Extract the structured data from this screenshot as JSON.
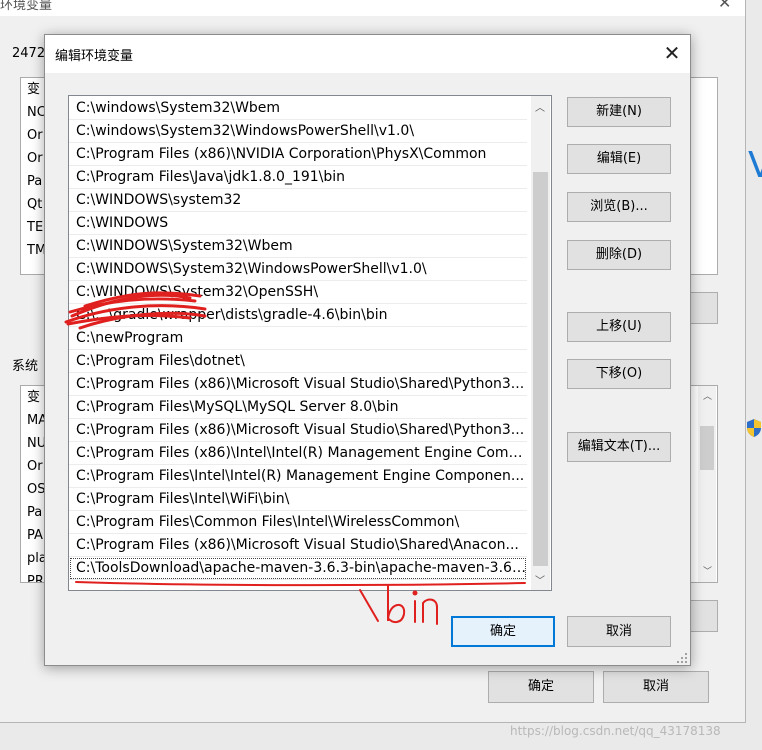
{
  "background_window": {
    "title": "环境变量",
    "close_glyph": "✕",
    "user_section_label": "2472",
    "user_vars_prefixes": [
      "变",
      "NC",
      "Or",
      "Or",
      "Pa",
      "Qt",
      "TE",
      "TM"
    ],
    "system_section_label": "系统",
    "system_vars_prefixes": [
      "变",
      "MA",
      "NU",
      "Or",
      "OS",
      "Pa",
      "PA",
      "pla",
      "PR"
    ],
    "ok_label": "确定",
    "cancel_label": "取消",
    "right_fragment": "V"
  },
  "dialog": {
    "title": "编辑环境变量",
    "close_glyph": "✕",
    "paths": [
      "C:\\windows\\System32\\Wbem",
      "C:\\windows\\System32\\WindowsPowerShell\\v1.0\\",
      "C:\\Program Files (x86)\\NVIDIA Corporation\\PhysX\\Common",
      "C:\\Program Files\\Java\\jdk1.8.0_191\\bin",
      "C:\\WINDOWS\\system32",
      "C:\\WINDOWS",
      "C:\\WINDOWS\\System32\\Wbem",
      "C:\\WINDOWS\\System32\\WindowsPowerShell\\v1.0\\",
      "C:\\WINDOWS\\System32\\OpenSSH\\",
      "C:\\...\\gradle\\wrapper\\dists\\gradle-4.6\\bin\\bin",
      "C:\\newProgram",
      "C:\\Program Files\\dotnet\\",
      "C:\\Program Files (x86)\\Microsoft Visual Studio\\Shared\\Python3...",
      "C:\\Program Files\\MySQL\\MySQL Server 8.0\\bin",
      "C:\\Program Files (x86)\\Microsoft Visual Studio\\Shared\\Python3...",
      "C:\\Program Files (x86)\\Intel\\Intel(R) Management Engine Comp...",
      "C:\\Program Files\\Intel\\Intel(R) Management Engine Componen...",
      "C:\\Program Files\\Intel\\WiFi\\bin\\",
      "C:\\Program Files\\Common Files\\Intel\\WirelessCommon\\",
      "C:\\Program Files (x86)\\Microsoft Visual Studio\\Shared\\Anacon...",
      "C:\\ToolsDownload\\apache-maven-3.6.3-bin\\apache-maven-3.6...."
    ],
    "selected_index": 20,
    "buttons": {
      "new": "新建(N)",
      "edit": "编辑(E)",
      "browse": "浏览(B)...",
      "delete": "删除(D)",
      "move_up": "上移(U)",
      "move_down": "下移(O)",
      "edit_text": "编辑文本(T)...",
      "ok": "确定",
      "cancel": "取消"
    }
  },
  "annotation": {
    "handwritten_text": "\\bin",
    "color": "#e0201e"
  },
  "watermark": "https://blog.csdn.net/qq_43178138"
}
